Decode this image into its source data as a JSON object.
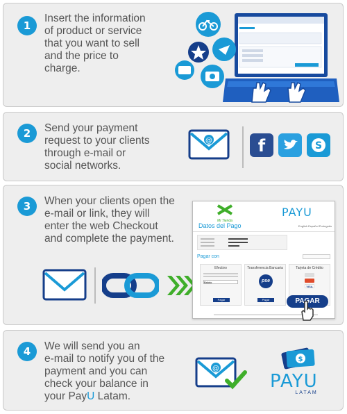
{
  "steps": [
    {
      "number": "1",
      "text": "Insert the information\nof product or service\nthat you want to sell\nand the price to\ncharge."
    },
    {
      "number": "2",
      "text": "Send your payment\nrequest to your clients\nthrough e-mail or\nsocial networks."
    },
    {
      "number": "3",
      "text": "When your clients open the\ne-mail or link, they will\nenter the web Checkout\nand complete the payment."
    },
    {
      "number": "4",
      "text_before": "We will send you an\ne-mail to notify you of the\npayment and you can\ncheck your balance in\nyour Pay",
      "text_highlight": "U",
      "text_after": " Latam."
    }
  ],
  "checkout": {
    "shop_name": "Mi Tienda",
    "brand": "PAYU",
    "languages": [
      "English",
      "Español",
      "Português"
    ],
    "title": "Datos del Pago",
    "pay_with": "Pagar con",
    "methods": [
      {
        "name": "Efectivo",
        "select_value": "Baloto",
        "button": "Pagar"
      },
      {
        "name": "Transferencia Bancaria",
        "logo": "pse",
        "button": "Pagar"
      },
      {
        "name": "Tarjeta de Crédito",
        "cards": [
          "VISA"
        ],
        "button": "Pagar"
      }
    ],
    "pay_button": "PAGAR"
  },
  "logo": {
    "brand": "PAYU",
    "sub": "LATAM"
  },
  "social": [
    "f",
    "twitter",
    "skype"
  ],
  "colors": {
    "accent": "#1a9ad6",
    "navy": "#153e8a",
    "green": "#3fae2a"
  }
}
